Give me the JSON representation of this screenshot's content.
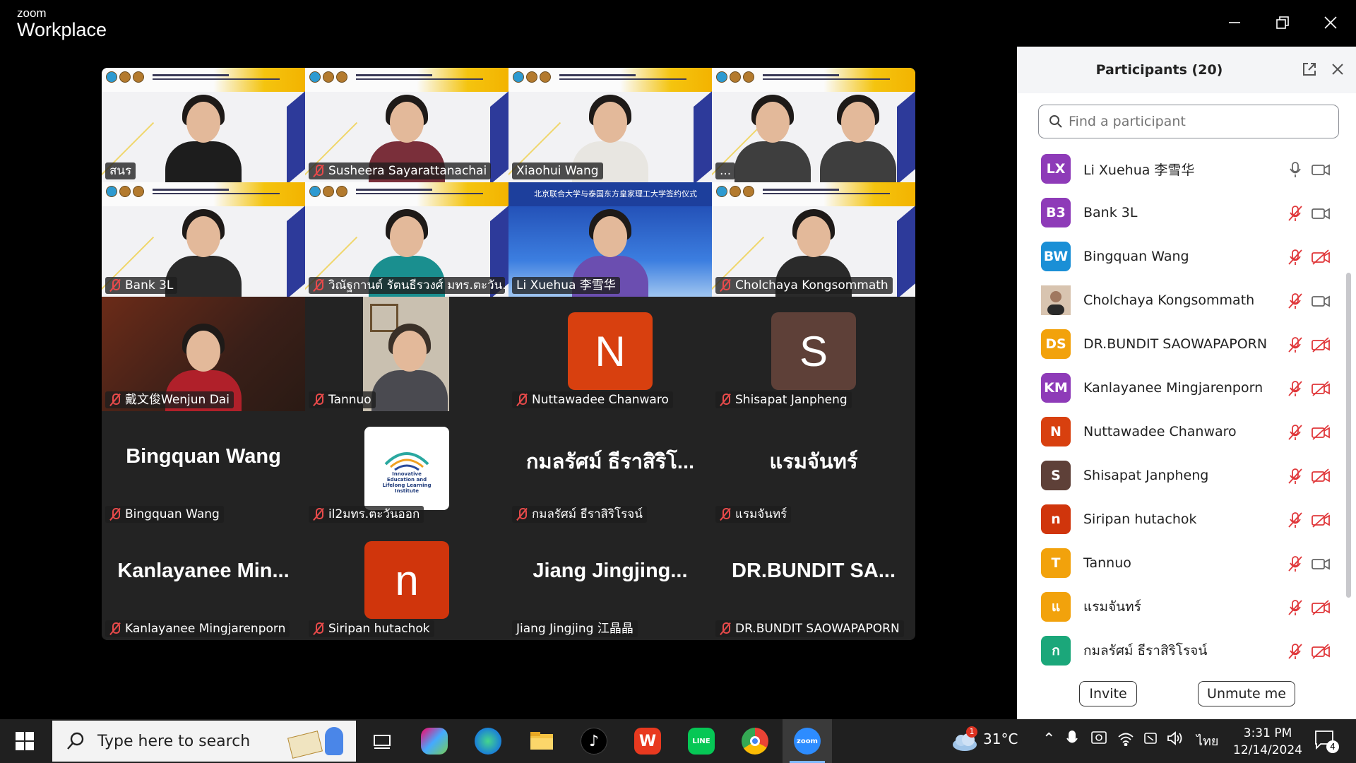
{
  "app": {
    "brand_small": "zoom",
    "brand_big": "Workplace"
  },
  "tiles": [
    {
      "label": "สนร",
      "muted": false
    },
    {
      "label": "Susheera Sayarattanachai",
      "muted": true
    },
    {
      "label": "Xiaohui Wang",
      "muted": false
    },
    {
      "label": "...",
      "muted": false
    },
    {
      "label": "Bank 3L",
      "muted": true
    },
    {
      "label": "วิณัฐกานต์ รัตนธีรวงศ์ มทร.ตะวัน...",
      "muted": true
    },
    {
      "label": "Li Xuehua 李雪华",
      "muted": false,
      "banner": "北京联合大学与泰国东方皇家理工大学签约仪式"
    },
    {
      "label": "Cholchaya Kongsommath",
      "muted": true
    },
    {
      "label": "戴文俊Wenjun Dai",
      "muted": true
    },
    {
      "label": "Tannuo",
      "muted": true
    },
    {
      "label": "Nuttawadee Chanwaro",
      "muted": true,
      "initial": "N"
    },
    {
      "label": "Shisapat Janpheng",
      "muted": true,
      "initial": "S"
    },
    {
      "label": "Bingquan Wang",
      "muted": true,
      "bigname": "Bingquan Wang"
    },
    {
      "label": "il2มทร.ตะวันออก",
      "muted": true,
      "logo_text": "Innovative Education and Lifelong Learning Institute"
    },
    {
      "label": "กมลรัศม์ ธีราสิริโรจน์",
      "muted": true,
      "bigname": "กมลรัศม์ ธีราสิริโ..."
    },
    {
      "label": "แรมจันทร์",
      "muted": true,
      "bigname": "แรมจันทร์"
    },
    {
      "label": "Kanlayanee Mingjarenporn",
      "muted": true,
      "bigname": "Kanlayanee  Min..."
    },
    {
      "label": "Siripan hutachok",
      "muted": true,
      "initial": "n"
    },
    {
      "label": "Jiang Jingjing 江晶晶",
      "muted": false,
      "bigname": "Jiang  Jingjing..."
    },
    {
      "label": "DR.BUNDIT SAOWAPAPORN",
      "muted": true,
      "bigname": "DR.BUNDIT  SA..."
    }
  ],
  "panel": {
    "title": "Participants (20)",
    "search_placeholder": "Find a participant",
    "participants": [
      {
        "initials": "LX",
        "name": "Li Xuehua 李雪华",
        "color": "#8e3bb8",
        "mic": "on",
        "video": "on"
      },
      {
        "initials": "B3",
        "name": "Bank 3L",
        "color": "#8e3bb8",
        "mic": "off",
        "video": "on"
      },
      {
        "initials": "BW",
        "name": "Bingquan Wang",
        "color": "#1a8fd6",
        "mic": "off",
        "video": "off"
      },
      {
        "initials": "",
        "name": "Cholchaya Kongsommath",
        "color": "#c9a58a",
        "mic": "off",
        "video": "on"
      },
      {
        "initials": "DS",
        "name": "DR.BUNDIT SAOWAPAPORN",
        "color": "#f2a20c",
        "mic": "off",
        "video": "off"
      },
      {
        "initials": "KM",
        "name": "Kanlayanee Mingjarenporn",
        "color": "#8e3bb8",
        "mic": "off",
        "video": "off"
      },
      {
        "initials": "N",
        "name": "Nuttawadee Chanwaro",
        "color": "#d8400f",
        "mic": "off",
        "video": "off"
      },
      {
        "initials": "S",
        "name": "Shisapat Janpheng",
        "color": "#5e4038",
        "mic": "off",
        "video": "off"
      },
      {
        "initials": "n",
        "name": "Siripan hutachok",
        "color": "#d0350c",
        "mic": "off",
        "video": "off"
      },
      {
        "initials": "T",
        "name": "Tannuo",
        "color": "#f2a20c",
        "mic": "off",
        "video": "on"
      },
      {
        "initials": "แ",
        "name": "แรมจันทร์",
        "color": "#f2a20c",
        "mic": "off",
        "video": "off"
      },
      {
        "initials": "ก",
        "name": "กมลรัศม์ ธีราสิริโรจน์",
        "color": "#1ba77a",
        "mic": "off",
        "video": "off"
      }
    ],
    "invite_label": "Invite",
    "unmute_label": "Unmute me"
  },
  "taskbar": {
    "search_placeholder": "Type here to search",
    "weather_temp": "31°C",
    "weather_badge": "1",
    "language": "ไทย",
    "time": "3:31 PM",
    "date": "12/14/2024",
    "notif_count": "4",
    "zoom_label": "zoom"
  }
}
